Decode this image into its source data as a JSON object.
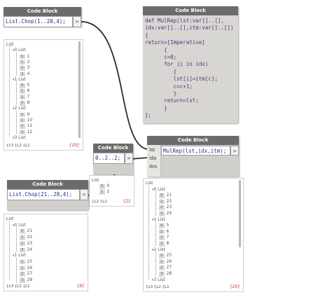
{
  "node_title": "Code Block",
  "port_symbol": ">",
  "nodes": {
    "chop1": {
      "code": "List.Chop(1..20,4);"
    },
    "mulrep": {
      "code_lines": [
        "def MulRep(lst:var[]..[],",
        "idx:var[]..[],itm:var[]..[])",
        "{",
        "return=[Imperative]",
        "      {",
        "      c=0;",
        "      for (i in idx)",
        "         {",
        "         lst[i]=itm[c];",
        "         c=c+1;",
        "         }",
        "      return=lst;",
        "      }",
        "};"
      ]
    },
    "range": {
      "code": "0..2..2;"
    },
    "call": {
      "code": "MulRep(lst,idx,itm);",
      "inputs": [
        "lst",
        "idx",
        "itm"
      ]
    },
    "chop2": {
      "code": "List.Chop(21..28,4);"
    }
  },
  "watch1": {
    "root": "List",
    "groups": [
      {
        "index": "0",
        "label": "List",
        "items": [
          [
            "0",
            "1"
          ],
          [
            "1",
            "2"
          ],
          [
            "2",
            "3"
          ],
          [
            "3",
            "4"
          ]
        ]
      },
      {
        "index": "1",
        "label": "List",
        "items": [
          [
            "0",
            "5"
          ],
          [
            "1",
            "6"
          ],
          [
            "2",
            "7"
          ],
          [
            "3",
            "8"
          ]
        ]
      },
      {
        "index": "2",
        "label": "List",
        "items": [
          [
            "0",
            "9"
          ],
          [
            "1",
            "10"
          ],
          [
            "2",
            "11"
          ],
          [
            "3",
            "12"
          ]
        ]
      },
      {
        "index": "3",
        "label": "List",
        "items": []
      }
    ],
    "levels": "{L3 {L2 {L1",
    "count": "{20}"
  },
  "watch_range": {
    "root": "List",
    "items": [
      [
        "0",
        "0"
      ],
      [
        "1",
        "2"
      ]
    ],
    "levels": "{L2 {L1",
    "count": "{2}"
  },
  "watch2": {
    "root": "List",
    "groups": [
      {
        "index": "0",
        "label": "List",
        "items": [
          [
            "0",
            "21"
          ],
          [
            "1",
            "22"
          ],
          [
            "2",
            "23"
          ],
          [
            "3",
            "24"
          ]
        ]
      },
      {
        "index": "1",
        "label": "List",
        "items": [
          [
            "0",
            "25"
          ],
          [
            "1",
            "26"
          ],
          [
            "2",
            "27"
          ],
          [
            "3",
            "28"
          ]
        ]
      }
    ],
    "levels": "{L3 {L2 {L1",
    "count": "{8}"
  },
  "watch_result": {
    "root": "List",
    "groups": [
      {
        "index": "0",
        "label": "List",
        "items": [
          [
            "0",
            "21"
          ],
          [
            "1",
            "22"
          ],
          [
            "2",
            "23"
          ],
          [
            "3",
            "24"
          ]
        ]
      },
      {
        "index": "1",
        "label": "List",
        "items": [
          [
            "0",
            "5"
          ],
          [
            "1",
            "6"
          ],
          [
            "2",
            "7"
          ],
          [
            "3",
            "8"
          ]
        ]
      },
      {
        "index": "2",
        "label": "List",
        "items": [
          [
            "0",
            "25"
          ],
          [
            "1",
            "26"
          ],
          [
            "2",
            "27"
          ],
          [
            "3",
            "28"
          ]
        ]
      },
      {
        "index": "3",
        "label": "List",
        "items": []
      }
    ],
    "levels": "{L3 {L2 {L1",
    "count": "{20}"
  }
}
